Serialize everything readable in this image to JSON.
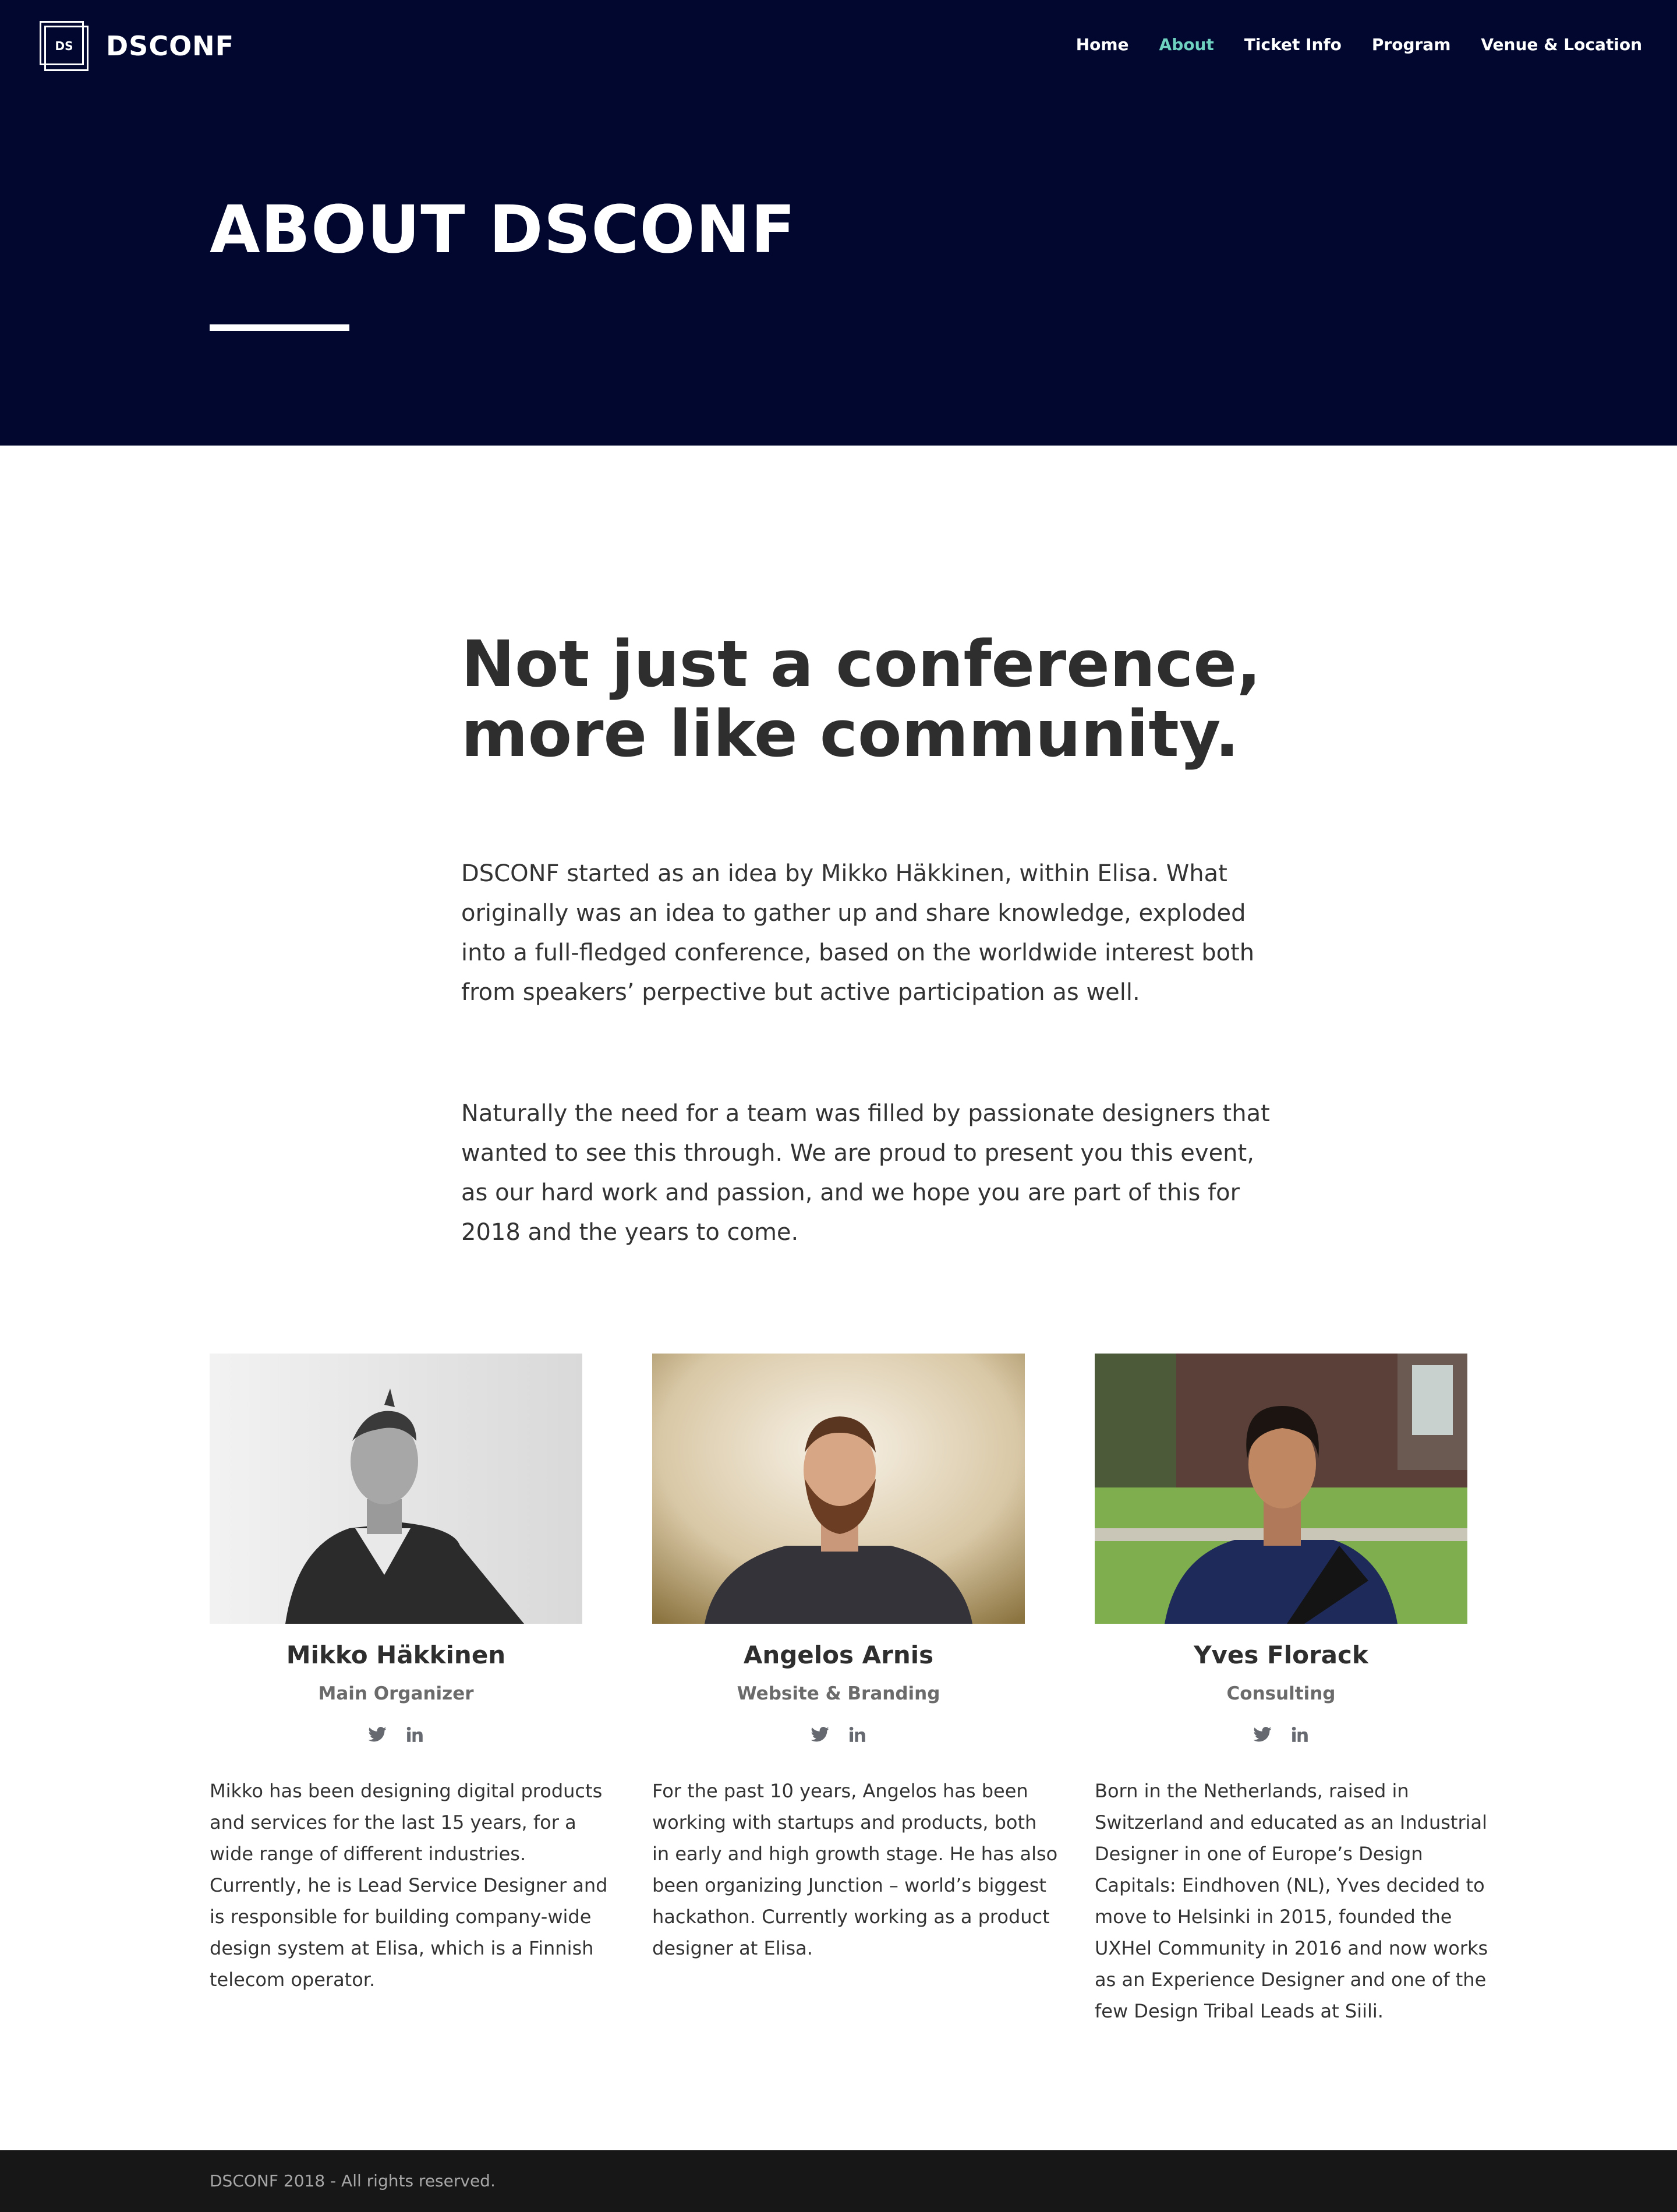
{
  "brand": {
    "logo_mark": "DS",
    "name": "DSCONF"
  },
  "nav": {
    "items": [
      {
        "label": "Home",
        "active": false
      },
      {
        "label": "About",
        "active": true
      },
      {
        "label": "Ticket Info",
        "active": false
      },
      {
        "label": "Program",
        "active": false
      },
      {
        "label": "Venue & Location",
        "active": false
      }
    ]
  },
  "hero": {
    "title": "ABOUT DSCONF"
  },
  "intro": {
    "heading_lines": [
      "Not just a conference,",
      "more like community."
    ],
    "paragraph1_lines": [
      "DSCONF started as an idea by Mikko Häkkinen, within Elisa. What",
      "originally was an idea to gather up and share knowledge, exploded",
      "into a full-fledged conference, based on the worldwide interest both",
      "from speakers’ perpective but active participation as well."
    ],
    "paragraph2_lines": [
      "Naturally the need for a team was filled by passionate designers that",
      "wanted to see this through. We are proud to present you this event,",
      "as our hard work and passion, and we hope you are part of this for",
      "2018 and the years to come."
    ]
  },
  "team": [
    {
      "name": "Mikko Häkkinen",
      "role": "Main Organizer",
      "photo_icon": "portrait-photo-icon",
      "bio_lines": [
        "Mikko has been designing digital products",
        "and services for the last 15 years, for a",
        "wide range of different industries.",
        "Currently, he is Lead Service Designer and",
        "is responsible for building company-wide",
        "design system at Elisa, which is a Finnish",
        "telecom operator."
      ]
    },
    {
      "name": "Angelos Arnis",
      "role": "Website & Branding",
      "photo_icon": "portrait-photo-icon",
      "bio_lines": [
        "For the past 10 years, Angelos has been",
        "working with startups and products, both",
        "in early and high growth stage. He has also",
        "been organizing Junction – world’s biggest",
        "hackathon. Currently working as a product",
        "designer at Elisa."
      ]
    },
    {
      "name": "Yves Florack",
      "role": "Consulting",
      "photo_icon": "portrait-photo-icon",
      "bio_lines": [
        "Born in the Netherlands, raised in",
        "Switzerland and educated as an Industrial",
        "Designer in one of Europe’s Design",
        "Capitals: Eindhoven (NL), Yves decided to",
        "move to Helsinki in 2015, founded the",
        "UXHel Community in 2016 and now works",
        "as an Experience Designer and one of the",
        "few Design Tribal Leads at Siili."
      ]
    }
  ],
  "footer": {
    "text": "DSCONF 2018 - All rights reserved."
  },
  "colors": {
    "hero_bg": "#01072f",
    "nav_active": "#6fd1c0",
    "footer_bg": "#171717"
  }
}
